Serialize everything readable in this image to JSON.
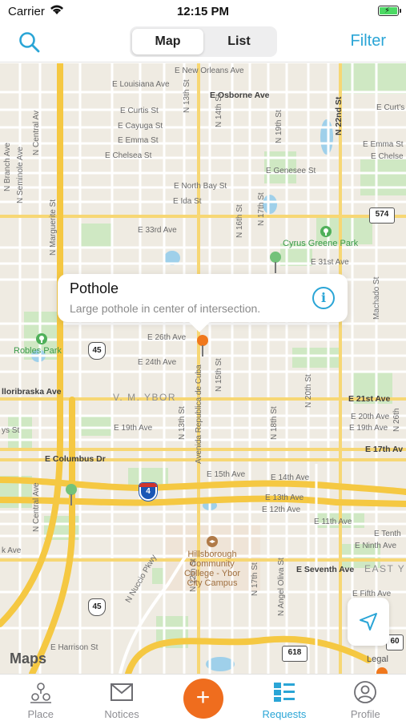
{
  "status_bar": {
    "carrier": "Carrier",
    "time": "12:15 PM"
  },
  "nav": {
    "search_icon": "magnifier-icon",
    "segments": [
      {
        "label": "Map",
        "selected": true
      },
      {
        "label": "List",
        "selected": false
      }
    ],
    "filter_label": "Filter",
    "accent_color": "#2aa5d6"
  },
  "map": {
    "callout": {
      "title": "Pothole",
      "subtitle": "Large pothole in center of intersection.",
      "info_icon": "info-icon"
    },
    "labels": {
      "new_orleans": "E New Orleans Ave",
      "louisiana": "E Louisiana Ave",
      "osborne": "E Osborne Ave",
      "curtis": "E Curtis St",
      "cayuga": "E Cayuga St",
      "emma": "E Emma St",
      "chelsea": "E Chelsea St",
      "genesee": "E Genesee St",
      "north_bay": "E North Bay St",
      "ida": "E Ida St",
      "ave33": "E 33rd Ave",
      "ave31": "E 31st Ave",
      "ave26": "E 26th Ave",
      "ave24": "E 24th Ave",
      "ave21": "E 21st Ave",
      "ave20": "E 20th Ave",
      "ave19_w": "E 19th Ave",
      "ave19_e": "E 19th Ave",
      "ave17": "E 17th Av",
      "columbus": "E Columbus Dr",
      "ave15": "E 15th Ave",
      "ave14": "E 14th Ave",
      "ave13": "E 13th Ave",
      "ave12": "E 12th Ave",
      "ave11": "E 11th Ave",
      "tenth": "E Tenth",
      "ninth": "E Ninth Ave",
      "seventh": "E Seventh Ave",
      "fifth": "E Fifth Ave",
      "harrison": "E Harrison St",
      "curtis_e": "E Curt's St",
      "emma_e": "E Emma St",
      "chelsea_e": "E Chelse",
      "nebraska": "lloribraska Ave",
      "east_y": "EAST Y",
      "ybor": "V. M. YBOR",
      "n22nd": "N 22nd St",
      "n19th": "N 19th St",
      "n16th": "N 16th St",
      "n17th": "N 17th St",
      "n15th": "N 15th St",
      "n13th": "N 13th St",
      "n18th": "N 18th St",
      "n20th": "N 20th St",
      "n12th": "N 12th St",
      "republica": "Avenida Republica de Cuba",
      "n14th": "N 14th St",
      "marguerite": "N Marguerite St",
      "central_n": "N Central Av",
      "central_s": "N Central Ave",
      "branch": "N Branch Ave",
      "seminole": "N Seminole Ave",
      "machado": "Machado St",
      "angel_oliva": "N Angel Oliva St",
      "nuccio": "N Nuccio Pkwy",
      "n26th": "N 26th",
      "parks": {
        "cyrus": "Cyrus Greene Park",
        "robles": "Robles Park"
      },
      "poi": "Hillsborough Community College - Ybor City Campus",
      "district_misc": "ys St",
      "k_ave": "k Ave"
    },
    "shields": {
      "r574": "574",
      "r45a": "45",
      "r45b": "45",
      "i4": "4",
      "r618": "618",
      "r60": "60"
    },
    "locate_icon": "location-arrow-icon",
    "attribution": "Maps",
    "legal": "Legal"
  },
  "tabs": [
    {
      "label": "Place",
      "icon": "place-pins-icon",
      "active": false
    },
    {
      "label": "Notices",
      "icon": "envelope-icon",
      "active": false
    },
    {
      "label": "",
      "icon": "plus-icon",
      "active": false,
      "add_symbol": "+"
    },
    {
      "label": "Requests",
      "icon": "list-icon",
      "active": true
    },
    {
      "label": "Profile",
      "icon": "person-icon",
      "active": false
    }
  ]
}
